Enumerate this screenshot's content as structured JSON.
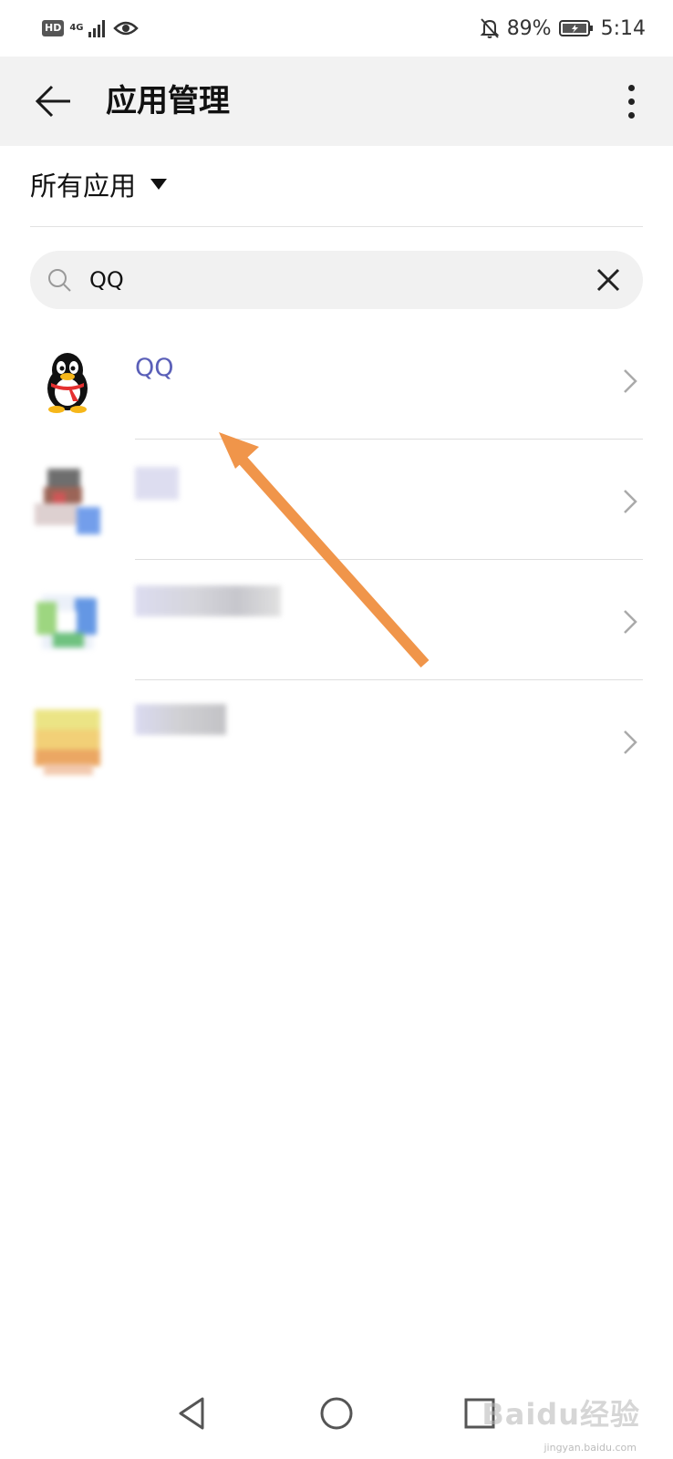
{
  "status_bar": {
    "hd": "HD",
    "network": "4G",
    "battery_percent": "89%",
    "time": "5:14",
    "icons": [
      "signal-icon",
      "eye-icon",
      "bell-off-icon",
      "battery-icon"
    ]
  },
  "app_bar": {
    "title": "应用管理",
    "back_icon": "back-arrow-icon",
    "more_icon": "more-vertical-icon"
  },
  "filter": {
    "label": "所有应用",
    "dropdown_icon": "caret-down-icon"
  },
  "search": {
    "value": "QQ",
    "icon": "search-icon",
    "clear_icon": "close-icon"
  },
  "apps": [
    {
      "name": "QQ",
      "icon": "qq-penguin-icon"
    },
    {
      "name": "",
      "icon": "pixelated-app-icon"
    },
    {
      "name": "",
      "icon": "pixelated-app-icon"
    },
    {
      "name": "",
      "icon": "pixelated-app-icon"
    }
  ],
  "nav_bar": {
    "icons": [
      "back-triangle-icon",
      "home-circle-icon",
      "recents-square-icon"
    ]
  },
  "watermark": {
    "brand": "Baidu经验",
    "url": "jingyan.baidu.com"
  },
  "colors": {
    "accent_link": "#5a5fb8",
    "annotation_arrow": "#f0954a",
    "app_bar_bg": "#f2f2f2"
  }
}
